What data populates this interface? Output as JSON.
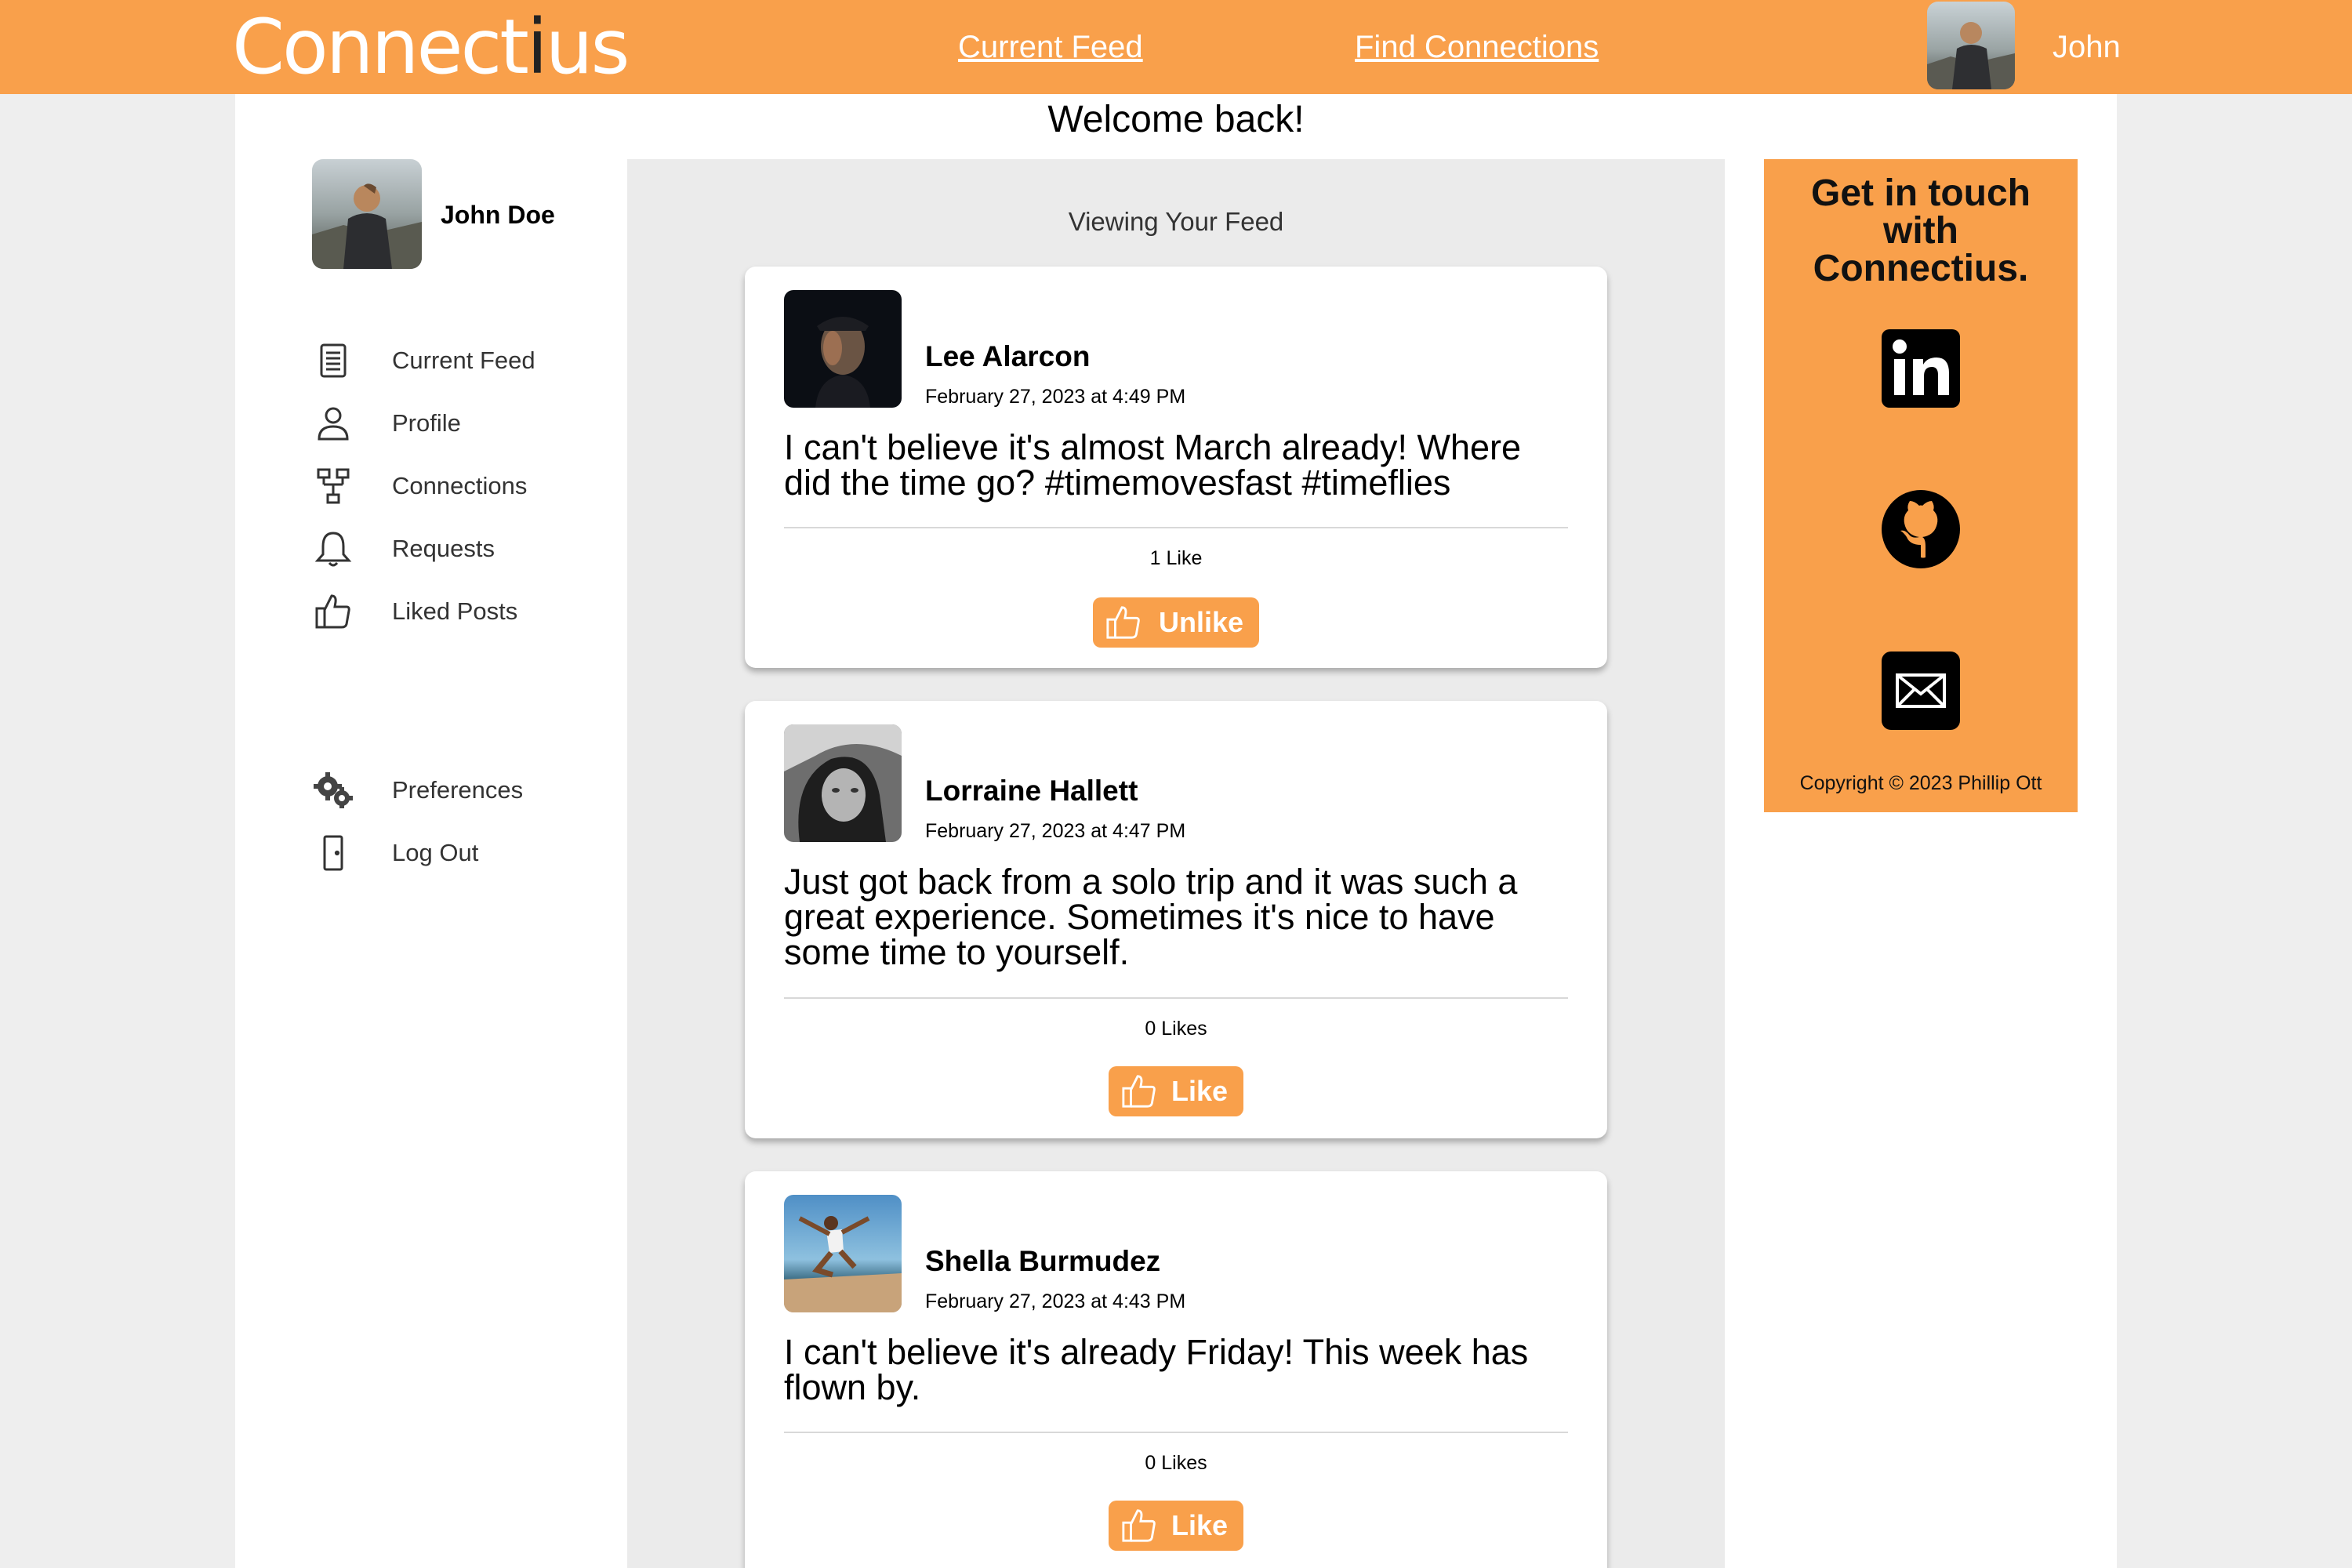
{
  "header": {
    "logo_part1": "Connect",
    "logo_part2": "i",
    "logo_part3": "us",
    "nav": [
      "Current Feed",
      "Find Connections"
    ],
    "user_name": "John"
  },
  "welcome": "Welcome back!",
  "sidebar": {
    "profile_name": "John Doe",
    "items": [
      {
        "label": "Current Feed",
        "icon": "newspaper-icon"
      },
      {
        "label": "Profile",
        "icon": "user-icon"
      },
      {
        "label": "Connections",
        "icon": "network-icon"
      },
      {
        "label": "Requests",
        "icon": "bell-icon"
      },
      {
        "label": "Liked Posts",
        "icon": "thumbs-up-icon"
      },
      {
        "label": "Preferences",
        "icon": "gears-icon"
      },
      {
        "label": "Log Out",
        "icon": "door-icon"
      }
    ]
  },
  "feed": {
    "title": "Viewing Your Feed",
    "posts": [
      {
        "author": "Lee Alarcon",
        "date": "February 27, 2023 at 4:49 PM",
        "body": "I can't believe it's almost March already! Where did the time go? #timemovesfast #timeflies",
        "likes": "1 Like",
        "button": "Unlike"
      },
      {
        "author": "Lorraine Hallett",
        "date": "February 27, 2023 at 4:47 PM",
        "body": "Just got back from a solo trip and it was such a great experience. Sometimes it's nice to have some time to yourself.",
        "likes": "0 Likes",
        "button": "Like"
      },
      {
        "author": "Shella Burmudez",
        "date": "February 27, 2023 at 4:43 PM",
        "body": "I can't believe it's already Friday! This week has flown by.",
        "likes": "0 Likes",
        "button": "Like"
      }
    ]
  },
  "contact": {
    "title_line1": "Get in touch",
    "title_line2": "with",
    "title_line3": "Connectius.",
    "icons": [
      "linkedin-icon",
      "github-icon",
      "mail-icon"
    ],
    "copyright": "Copyright © 2023 Phillip Ott"
  },
  "colors": {
    "accent": "#f9a04b",
    "feed_bg": "#ebebeb",
    "page_bg": "#eeeeee"
  }
}
